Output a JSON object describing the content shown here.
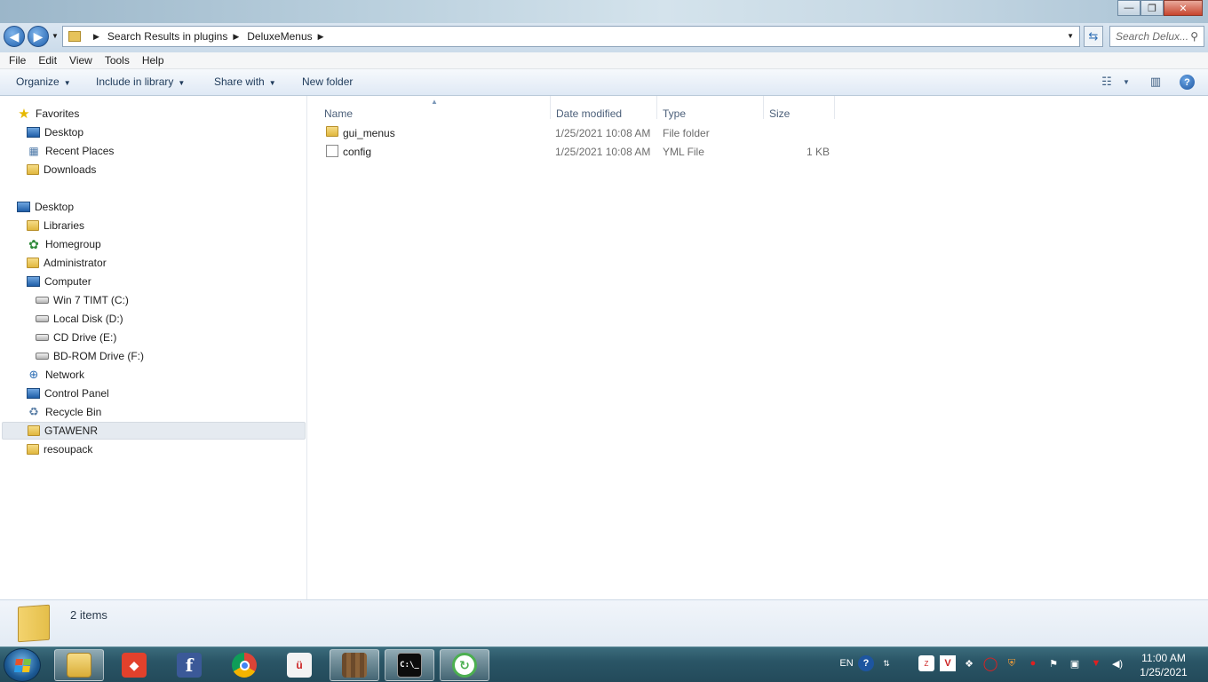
{
  "window": {
    "minimize_label": "—",
    "maximize_label": "❐",
    "close_label": "✕"
  },
  "address": {
    "crumbs": [
      "Search Results in plugins",
      "DeluxeMenus"
    ],
    "search_placeholder": "Search Delux..."
  },
  "menubar": [
    "File",
    "Edit",
    "View",
    "Tools",
    "Help"
  ],
  "commandbar": {
    "organize": "Organize",
    "include": "Include in library",
    "share": "Share with",
    "newfolder": "New folder"
  },
  "nav": {
    "favorites": "Favorites",
    "fav_items": [
      "Desktop",
      "Recent Places",
      "Downloads"
    ],
    "desktop": "Desktop",
    "libraries": "Libraries",
    "homegroup": "Homegroup",
    "administrator": "Administrator",
    "computer": "Computer",
    "drives": [
      "Win 7 TIMT (C:)",
      "Local Disk (D:)",
      "CD Drive (E:)",
      "BD-ROM Drive (F:)"
    ],
    "network": "Network",
    "controlpanel": "Control Panel",
    "recycle": "Recycle Bin",
    "folders": [
      "GTAWENR",
      "resoupack"
    ]
  },
  "columns": {
    "name": "Name",
    "date": "Date modified",
    "type": "Type",
    "size": "Size"
  },
  "files": [
    {
      "name": "gui_menus",
      "date": "1/25/2021 10:08 AM",
      "type": "File folder",
      "size": ""
    },
    {
      "name": "config",
      "date": "1/25/2021 10:08 AM",
      "type": "YML File",
      "size": "1 KB"
    }
  ],
  "status": {
    "items": "2 items"
  },
  "taskbar": {
    "lang": "EN",
    "time": "11:00 AM",
    "date": "1/25/2021"
  },
  "colors": {
    "accent": "#1e5fad",
    "selection": "#e5eaf0",
    "taskbar": "#2a5566"
  }
}
